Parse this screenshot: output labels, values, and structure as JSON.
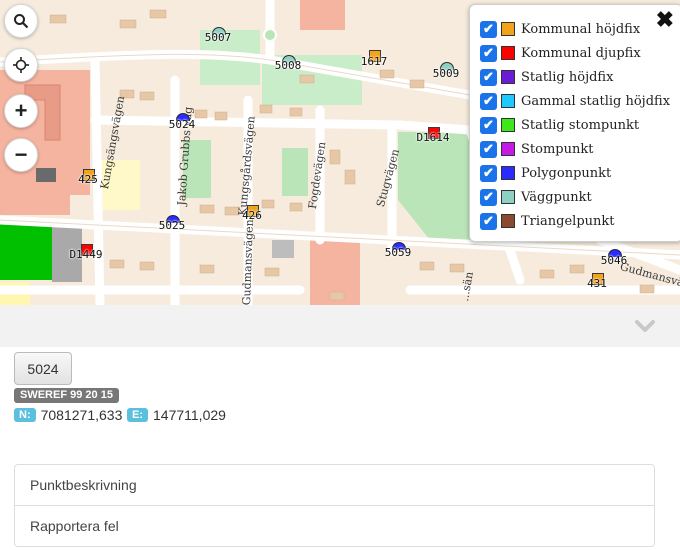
{
  "map": {
    "road_labels": [
      "Kungsängsvägen",
      "Jakob Grubbs väg",
      "Kungsgårdsvägen",
      "Gudmansvägen",
      "Fogdevägen",
      "Stugvägen",
      "Kungsgårdsvägen",
      "Gudmansvägen",
      "...sän"
    ],
    "markers": [
      {
        "id": "5007",
        "type": "väggpunkt"
      },
      {
        "id": "5008",
        "type": "väggpunkt"
      },
      {
        "id": "1617",
        "type": "kommunal-hojdfix"
      },
      {
        "id": "5009",
        "type": "väggpunkt"
      },
      {
        "id": "5024",
        "type": "polygonpunkt"
      },
      {
        "id": "D1614",
        "type": "kommunal-djupfix"
      },
      {
        "id": "425",
        "type": "kommunal-hojdfix"
      },
      {
        "id": "426",
        "type": "kommunal-hojdfix"
      },
      {
        "id": "5025",
        "type": "polygonpunkt"
      },
      {
        "id": "D1449",
        "type": "kommunal-djupfix"
      },
      {
        "id": "5059",
        "type": "polygonpunkt"
      },
      {
        "id": "5046",
        "type": "polygonpunkt"
      },
      {
        "id": "431",
        "type": "kommunal-hojdfix"
      }
    ]
  },
  "controls": {
    "search_icon": "search-icon",
    "locate_icon": "crosshair-icon",
    "zoom_in": "+",
    "zoom_out": "−"
  },
  "legend": {
    "close_icon": "✖",
    "items": [
      {
        "label": "Kommunal höjdfix",
        "color": "#f2a31b",
        "checked": true
      },
      {
        "label": "Kommunal djupfix",
        "color": "#ff0000",
        "checked": true
      },
      {
        "label": "Statlig höjdfix",
        "color": "#6a1bd6",
        "checked": true
      },
      {
        "label": "Gammal statlig höjdfix",
        "color": "#1ec9ff",
        "checked": true
      },
      {
        "label": "Statlig stompunkt",
        "color": "#3ce81a",
        "checked": true
      },
      {
        "label": "Stompunkt",
        "color": "#c31ae6",
        "checked": true
      },
      {
        "label": "Polygonpunkt",
        "color": "#2b2bff",
        "checked": true
      },
      {
        "label": "Väggpunkt",
        "color": "#8fd0c4",
        "checked": true
      },
      {
        "label": "Triangelpunkt",
        "color": "#8b4a2f",
        "checked": true
      }
    ]
  },
  "panel": {
    "point_id": "5024",
    "system": "SWEREF 99 20 15",
    "n_label": "N:",
    "n_value": "7081271,633",
    "e_label": "E:",
    "e_value": "147711,029",
    "links": [
      "Punktbeskrivning",
      "Rapportera fel"
    ]
  }
}
